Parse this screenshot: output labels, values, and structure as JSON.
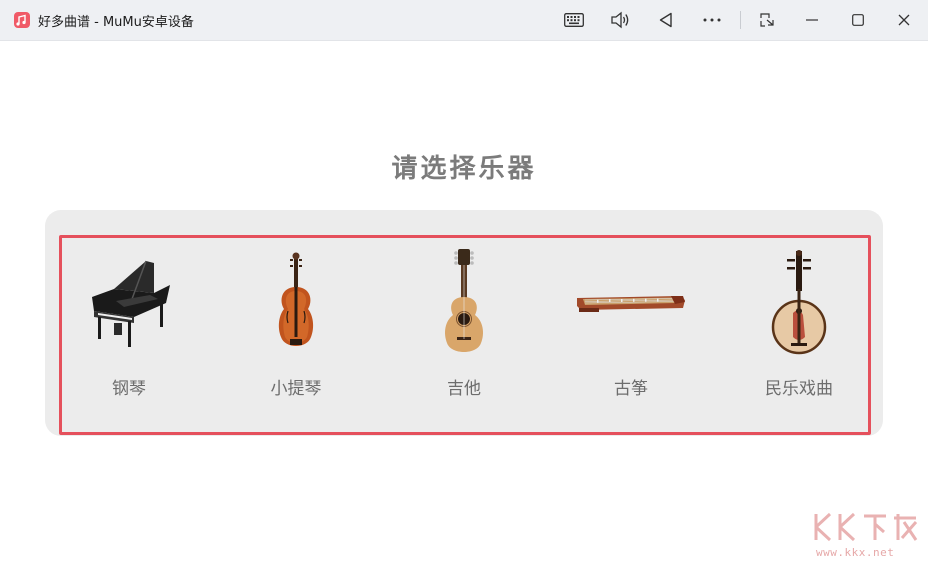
{
  "window": {
    "title": "好多曲谱 - MuMu安卓设备",
    "app_icon": "music-score-app-icon",
    "toolbar_icons": [
      "keyboard-icon",
      "volume-icon",
      "back-icon",
      "more-icon",
      "screenshot-icon",
      "minimize-icon",
      "maximize-icon",
      "close-icon"
    ]
  },
  "page": {
    "heading": "请选择乐器"
  },
  "instruments": [
    {
      "label": "钢琴",
      "icon": "piano-image"
    },
    {
      "label": "小提琴",
      "icon": "violin-image"
    },
    {
      "label": "吉他",
      "icon": "guitar-image"
    },
    {
      "label": "古筝",
      "icon": "guzheng-image"
    },
    {
      "label": "民乐戏曲",
      "icon": "pipa-image"
    }
  ],
  "colors": {
    "highlight_border": "#e5505c",
    "panel_bg": "#ececec",
    "heading": "#7b7b7b"
  },
  "watermark": {
    "logo": "KK下载",
    "url": "www.kkx.net"
  }
}
